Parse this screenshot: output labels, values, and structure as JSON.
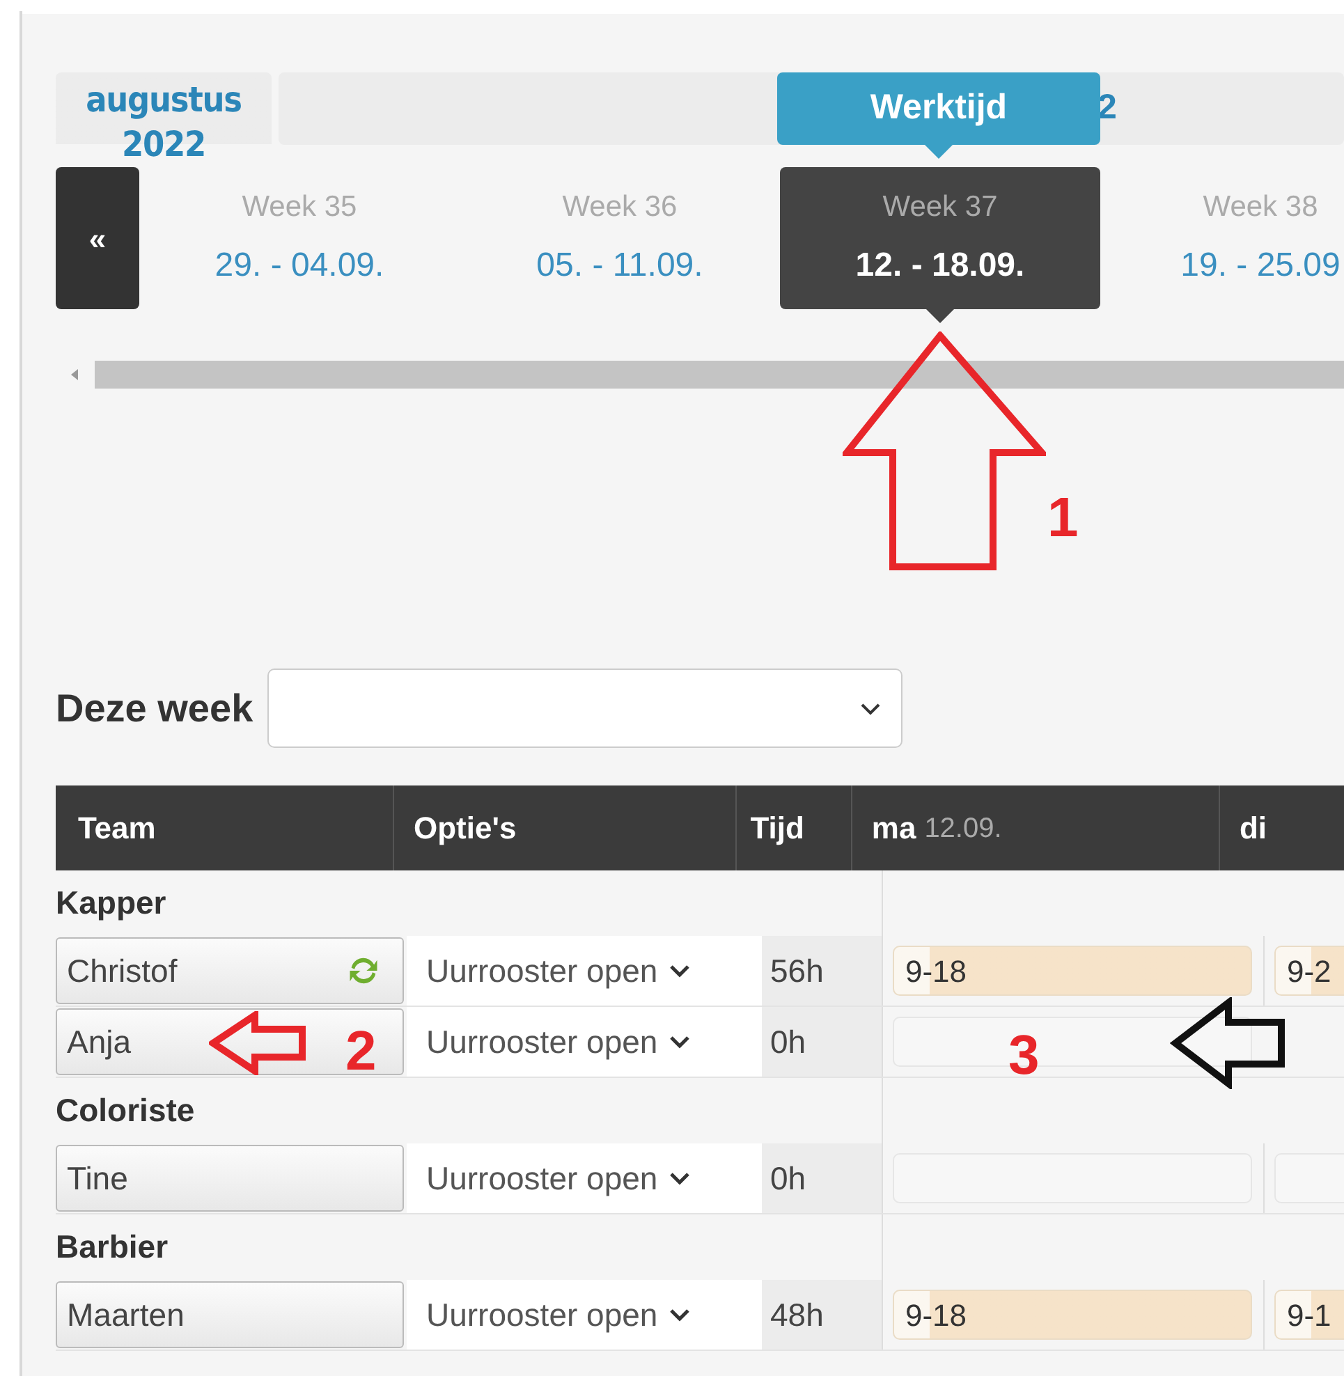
{
  "month_tab": {
    "label": "augustus 2022"
  },
  "hidden_tab_fragment": "2",
  "tooltip": {
    "label": "Werktijd"
  },
  "prev_button": {
    "label": "«"
  },
  "weeks": [
    {
      "week": "Week 35",
      "range": "29. - 04.09.",
      "selected": false
    },
    {
      "week": "Week 36",
      "range": "05. - 11.09.",
      "selected": false
    },
    {
      "week": "Week 37",
      "range": "12. - 18.09.",
      "selected": true
    },
    {
      "week": "Week 38",
      "range": "19. - 25.09",
      "selected": false
    }
  ],
  "week_select": {
    "label": "Deze week"
  },
  "table": {
    "columns": [
      "Team",
      "Optie's",
      "Tijd"
    ],
    "days": [
      {
        "day": "ma",
        "date": "12.09."
      },
      {
        "day": "di"
      }
    ],
    "groups": [
      {
        "name": "Kapper",
        "members": [
          {
            "name": "Christof",
            "synced": true,
            "option": "Uurrooster open",
            "time": "56h",
            "days": [
              {
                "text": "9-18",
                "filled": true
              },
              {
                "text": "9-2",
                "filled": true
              }
            ]
          },
          {
            "name": "Anja",
            "synced": false,
            "option": "Uurrooster open",
            "time": "0h",
            "days": [
              {
                "filled": false
              }
            ]
          }
        ]
      },
      {
        "name": "Coloriste",
        "members": [
          {
            "name": "Tine",
            "synced": false,
            "option": "Uurrooster open",
            "time": "0h",
            "days": [
              {
                "filled": false
              },
              {
                "filled": false
              }
            ]
          }
        ]
      },
      {
        "name": "Barbier",
        "members": [
          {
            "name": "Maarten",
            "synced": false,
            "option": "Uurrooster open",
            "time": "48h",
            "days": [
              {
                "text": "9-18",
                "filled": true
              },
              {
                "text": "9-1",
                "filled": true
              }
            ]
          }
        ]
      }
    ]
  },
  "annotations": [
    {
      "kind": "red-up-arrow",
      "label": "1"
    },
    {
      "kind": "red-left-arrow",
      "label": "2"
    },
    {
      "kind": "black-left-arrow",
      "label": "3"
    }
  ]
}
